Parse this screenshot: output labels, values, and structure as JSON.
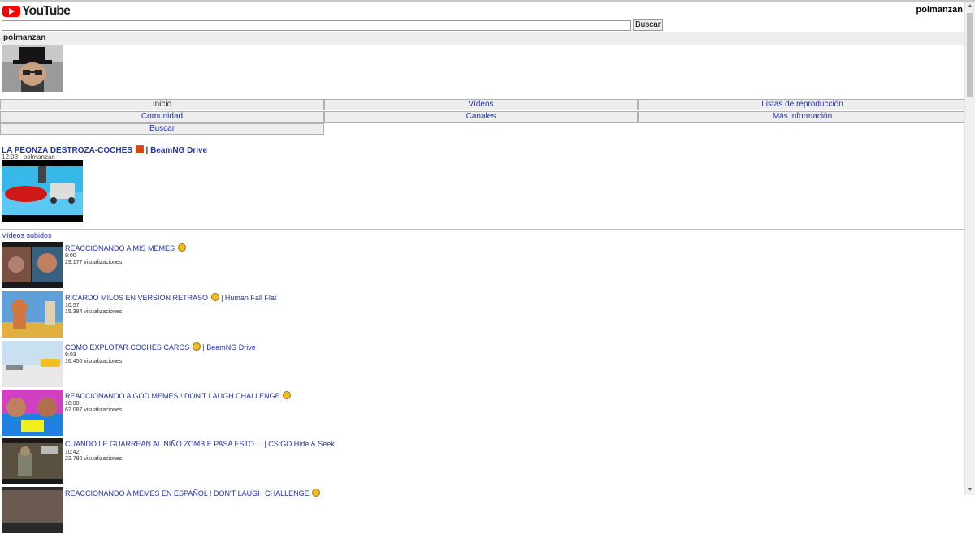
{
  "header": {
    "logo_text": "YouTube",
    "username": "polmanzan"
  },
  "search": {
    "value": "",
    "button_label": "Buscar"
  },
  "channel": {
    "name": "polmanzan"
  },
  "nav": {
    "items": [
      "Inicio",
      "Vídeos",
      "Listas de reproducción",
      "Comunidad",
      "Canales",
      "Más información",
      "Buscar"
    ]
  },
  "featured": {
    "title_a": "LA PEONZA DESTROZA-COCHES",
    "title_b": "| BeamNG Drive",
    "duration": "12:03",
    "author": "polmanzan"
  },
  "uploads": {
    "label": "Vídeos subidos",
    "videos": [
      {
        "title": "REACCIONANDO A MIS MEMES",
        "suffix": "",
        "duration": "9:00",
        "views": "29.177 visualizaciones"
      },
      {
        "title": "RICARDO MILOS EN VERSION RETRASO",
        "suffix": "| Human Fall Flat",
        "duration": "10:57",
        "views": "15.384 visualizaciones"
      },
      {
        "title": "COMO EXPLOTAR COCHES CAROS",
        "suffix": "| BeamNG Drive",
        "duration": "9:03",
        "views": "16.450 visualizaciones"
      },
      {
        "title": "REACCIONANDO A GOD MEMES ! DON'T LAUGH CHALLENGE",
        "suffix": "",
        "duration": "10:08",
        "views": "62.087 visualizaciones"
      },
      {
        "title": "CUANDO LE GUARREAN AL NIÑO ZOMBIE PASA ESTO ... | CS:GO Hide & Seek",
        "suffix": "",
        "duration": "10:42",
        "views": "22.780 visualizaciones"
      },
      {
        "title": "REACCIONANDO A MEMES EN ESPAÑOL ! DON'T LAUGH CHALLENGE",
        "suffix": "",
        "duration": "",
        "views": ""
      }
    ]
  }
}
